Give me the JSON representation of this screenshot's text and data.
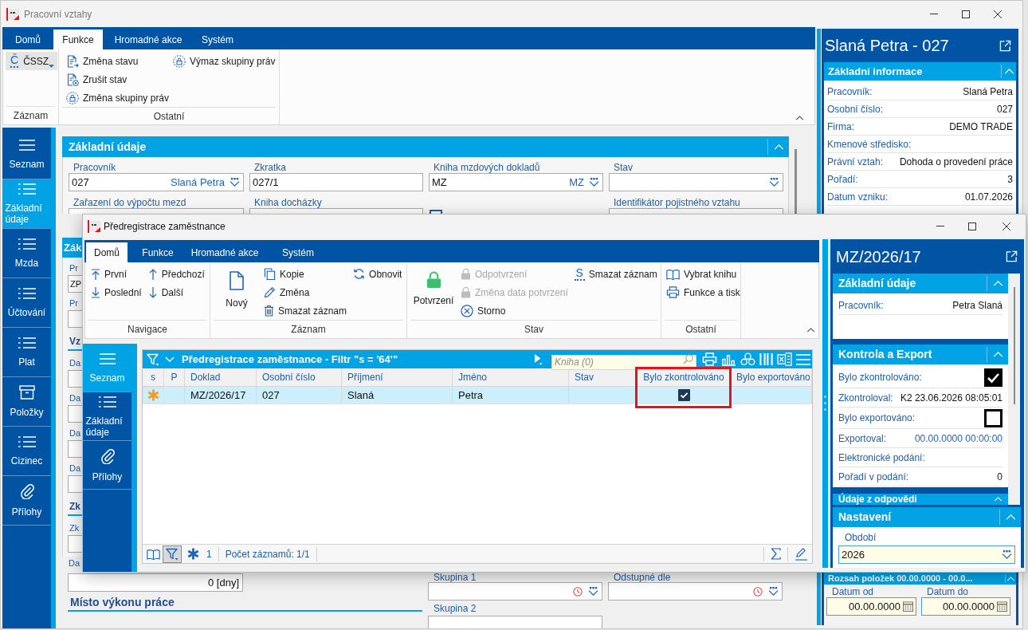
{
  "main_window": {
    "title": "Pracovní vztahy",
    "ribbon": {
      "tabs": [
        {
          "label": "Domů",
          "selected": false
        },
        {
          "label": "Funkce",
          "selected": true
        },
        {
          "label": "Hromadné akce",
          "selected": false
        },
        {
          "label": "Systém",
          "selected": false
        }
      ],
      "groups": [
        {
          "label": "Záznam",
          "columns": [
            [
              {
                "kind": "dropdown",
                "icon_text": "Č",
                "label": "ČSSZ"
              }
            ]
          ]
        },
        {
          "label": "Ostatní",
          "columns": [
            [
              {
                "kind": "small",
                "label": "Změna stavu"
              },
              {
                "kind": "small",
                "label": "Zrušit stav"
              },
              {
                "kind": "small",
                "label": "Změna skupiny práv"
              }
            ],
            [
              {
                "kind": "small",
                "label": "Výmaz skupiny práv"
              }
            ]
          ]
        }
      ]
    },
    "nav": [
      {
        "label": "Seznam",
        "selected": false
      },
      {
        "label": "Základní údaje",
        "selected": true
      },
      {
        "label": "Mzda",
        "selected": false
      },
      {
        "label": "Účtování",
        "selected": false
      },
      {
        "label": "Plat",
        "selected": false
      },
      {
        "label": "Položky",
        "selected": false
      },
      {
        "label": "Cizinec",
        "selected": false
      },
      {
        "label": "Přílohy",
        "selected": false
      }
    ],
    "form": {
      "section": {
        "title": "Základní údaje",
        "fields": [
          {
            "label": "Pracovník",
            "value": "027",
            "lookup": "Slaná Petra",
            "dropdown": true
          },
          {
            "label": "Zkratka",
            "value": "027/1",
            "dropdown": false
          },
          {
            "label": "Kniha mzdových dokladů",
            "value": "MZ",
            "lookup": "MZ",
            "dropdown": true
          },
          {
            "label": "Stav",
            "dropdown": true
          }
        ],
        "fields_row_2": [
          {
            "kind": "field",
            "label": "Zařazení do výpočtu mezd"
          },
          {
            "kind": "field",
            "label": "Kniha docházky"
          },
          {
            "kind": "checkbox",
            "checked": false
          },
          {
            "kind": "field",
            "label": "Identifikátor pojistného vztahu"
          }
        ]
      },
      "covered_section": {
        "title": "Zák",
        "items": [
          {
            "kind": "field",
            "label": "Pr",
            "value": "ZP"
          },
          {
            "kind": "field",
            "label": "Pr"
          },
          {
            "kind": "heading",
            "label": "Vz"
          },
          {
            "kind": "field",
            "label": "Da"
          },
          {
            "kind": "field",
            "label": "Da"
          },
          {
            "kind": "field",
            "label": "Da"
          },
          {
            "kind": "field",
            "label": "Da"
          },
          {
            "kind": "heading",
            "label": "Zk"
          },
          {
            "kind": "field",
            "label": "Zk"
          }
        ]
      },
      "duration_field": {
        "label": "Da",
        "value": "0 [dny]"
      },
      "subheading": "Místo výkonu práce",
      "group_fields": [
        {
          "label": "Skupina 1"
        },
        {
          "label": "Skupina 2"
        }
      ],
      "severance_field": {
        "label": "Odstupné dle"
      }
    },
    "info_panel": {
      "title": "Slaná Petra - 027",
      "section": {
        "title": "Základní informace",
        "rows": [
          {
            "label": "Pracovník:",
            "value": "Slaná Petra"
          },
          {
            "label": "Osobní číslo:",
            "value": "027"
          },
          {
            "label": "Firma:",
            "value": "DEMO TRADE"
          },
          {
            "label": "Kmenové středisko:"
          },
          {
            "label": "Právní vztah:",
            "value": "Dohoda o provedení práce"
          },
          {
            "label": "Pořadí:",
            "value": "3"
          },
          {
            "label": "Datum vzniku:",
            "value": "01.07.2026"
          }
        ]
      },
      "range_section": {
        "title": "Rozsah položek 00.00.0000 - 00.0...",
        "fields": [
          {
            "label": "Datum od",
            "value": "00.00.0000"
          },
          {
            "label": "Datum do",
            "value": "00.00.0000"
          }
        ]
      }
    }
  },
  "dialog": {
    "title": "Předregistrace zaměstnance",
    "ribbon": {
      "tabs": [
        {
          "label": "Domů",
          "selected": true
        },
        {
          "label": "Funkce",
          "selected": false
        },
        {
          "label": "Hromadné akce",
          "selected": false
        },
        {
          "label": "Systém",
          "selected": false
        }
      ],
      "groups": [
        {
          "label": "Navigace",
          "columns": [
            [
              {
                "kind": "small",
                "label": "První",
                "disabled": false
              },
              {
                "kind": "small",
                "label": "Poslední",
                "disabled": false
              }
            ],
            [
              {
                "kind": "small",
                "label": "Předchozí",
                "disabled": false
              },
              {
                "kind": "small",
                "label": "Další",
                "disabled": false
              }
            ]
          ]
        },
        {
          "label": "Záznam",
          "columns": [
            [
              {
                "kind": "large",
                "label": "Nový",
                "disabled": false
              }
            ],
            [
              {
                "kind": "small",
                "label": "Kopie",
                "disabled": false
              },
              {
                "kind": "small",
                "label": "Změna",
                "disabled": false
              },
              {
                "kind": "small",
                "label": "Smazat záznam",
                "disabled": false
              }
            ],
            [
              {
                "kind": "small",
                "label": "Obnovit",
                "disabled": false
              }
            ]
          ]
        },
        {
          "label": "Stav",
          "columns": [
            [
              {
                "kind": "large",
                "label": "Potvrzení",
                "disabled": false
              }
            ],
            [
              {
                "kind": "small",
                "label": "Odpotvrzení",
                "disabled": true
              },
              {
                "kind": "small",
                "label": "Změna data potvrzení",
                "disabled": true
              },
              {
                "kind": "small",
                "label": "Storno",
                "disabled": false
              }
            ],
            [
              {
                "kind": "small",
                "icon_text": "S",
                "label": "Smazat záznam",
                "disabled": false
              }
            ]
          ]
        },
        {
          "label": "Ostatní",
          "columns": [
            [
              {
                "kind": "small",
                "label": "Vybrat knihu",
                "disabled": false
              },
              {
                "kind": "small",
                "label": "Funkce a tisk",
                "disabled": false
              }
            ]
          ]
        }
      ]
    },
    "nav": [
      {
        "label": "Seznam",
        "selected": true
      },
      {
        "label": "Základní údaje",
        "selected": false
      },
      {
        "label": "Přílohy",
        "selected": false
      }
    ],
    "table": {
      "title": "Předregistrace zaměstnance - Filtr \"s = '64'\"",
      "search": {
        "placeholder": "Kniha (0)"
      },
      "columns": [
        {
          "label": "s",
          "kind": "marker",
          "highlighted": false
        },
        {
          "label": "P",
          "kind": "text",
          "highlighted": false
        },
        {
          "label": "Doklad",
          "kind": "text",
          "highlighted": false
        },
        {
          "label": "Osobní číslo",
          "kind": "text",
          "highlighted": false
        },
        {
          "label": "Příjmení",
          "kind": "text",
          "highlighted": false
        },
        {
          "label": "Jméno",
          "kind": "text",
          "highlighted": false
        },
        {
          "label": "Stav",
          "kind": "text",
          "highlighted": false
        },
        {
          "label": "Bylo zkontrolováno",
          "kind": "check",
          "highlighted": true
        },
        {
          "label": "Bylo exportováno",
          "kind": "check",
          "highlighted": false
        }
      ],
      "rows": [
        {
          "selected": true,
          "marked": true,
          "doklad": "MZ/2026/17",
          "osobni_cislo": "027",
          "prijmeni": "Slaná",
          "jmeno": "Petra",
          "bylo_zkontrolovano": true,
          "bylo_exportovano": false
        }
      ],
      "footer": {
        "filter_active": true,
        "count": "1",
        "record_count": "Počet záznamů: 1/1"
      }
    },
    "detail_panel": {
      "title": "MZ/2026/17",
      "sections": [
        {
          "title": "Základní údaje",
          "rows": [
            {
              "kind": "text",
              "label": "Pracovník:",
              "value": "Petra Slaná"
            }
          ]
        },
        {
          "title": "Kontrola a Export",
          "rows": [
            {
              "kind": "check",
              "label": "Bylo zkontrolováno:",
              "checked": true
            },
            {
              "kind": "text",
              "label": "Zkontroloval:",
              "value": "K2 23.06.2026 08:05:01"
            },
            {
              "kind": "check",
              "label": "Bylo exportováno:",
              "checked": false
            },
            {
              "kind": "link",
              "label": "Exportoval:",
              "value": "00.00.0000 00:00:00"
            },
            {
              "kind": "text",
              "label": "Elektronické podání:"
            },
            {
              "kind": "text",
              "label": "Pořadí v podání:",
              "value": "0"
            }
          ]
        },
        {
          "title": "Údaje z odpovědi"
        }
      ],
      "settings": {
        "title": "Nastavení",
        "fields": [
          {
            "label": "Období",
            "value": "2026"
          }
        ]
      }
    }
  }
}
